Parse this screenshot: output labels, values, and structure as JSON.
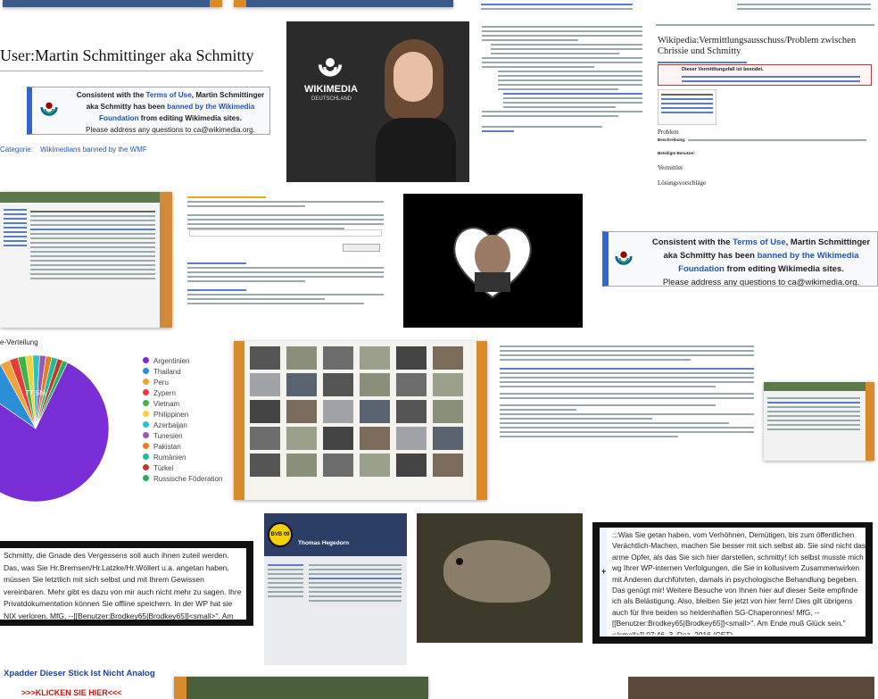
{
  "user_tile": {
    "heading": "User:Martin Schmittinger aka Schmitty",
    "notice_prefix": "Consistent with the ",
    "terms_link": "Terms of Use",
    "notice_mid": ", Martin Schmittinger aka Schmitty has been ",
    "banned_link": "banned by the Wikimedia Foundation",
    "notice_end": " from editing Wikimedia sites.",
    "contact": "Please address any questions to ca@wikimedia.org.",
    "category_label": "Categorie:",
    "category_value": "Wikimedians banned by the WMF"
  },
  "wmde_tile": {
    "logo_line1": "WIKIMEDIA",
    "logo_line2": "DEUTSCHLAND"
  },
  "vermittlung_tile": {
    "title": "Wikipedia:Vermittlungsausschuss/Problem zwischen Chrissie und Schmitty",
    "box_title": "Dieser Vermittlungsfall ist beendet.",
    "section1": "Problem",
    "section2": "Vermittler",
    "section3": "Lösungsvorschläge",
    "label_beschreibung": "Beschreibung:",
    "label_beteiligte": "Beteiligte Benutzer:"
  },
  "notice_tile": {
    "prefix": "Consistent with the ",
    "terms_link": "Terms of Use",
    "mid": ", Martin Schmittinger aka Schmitty has been ",
    "banned_link": "banned by the Wikimedia Foundation",
    "end": " from editing Wikimedia sites.",
    "contact": "Please address any questions to ca@wikimedia.org."
  },
  "chart_data": {
    "type": "pie",
    "title": "e-Verteilung",
    "categories": [
      "Argentinien",
      "Thailand",
      "Peru",
      "Zypern",
      "Vietnam",
      "Philippinen",
      "Azerbaijan",
      "Tunesien",
      "Pakistan",
      "Rumänien",
      "Türkei",
      "Russische Föderation"
    ],
    "values": [
      77.5,
      7.3,
      2.2,
      1.9,
      1.7,
      1.6,
      1.5,
      1.4,
      1.3,
      1.3,
      1.2,
      1.1
    ],
    "data_labels": [
      "77,5%",
      "7,3%"
    ],
    "colors": [
      "#7a2fd6",
      "#2a8fd6",
      "#f2a23a",
      "#e63b3b",
      "#3bb54a",
      "#f2d23a",
      "#2ac2c2",
      "#9b59b6",
      "#e67e22",
      "#1abc9c",
      "#c0392b",
      "#27ae60"
    ],
    "legend_position": "right"
  },
  "comment_tile": {
    "text": "Schmitty, die Gnade des Vergessens soll auch ihnen zuteil werden. Das, was Sie Hr.Bremsen/Hr.Latzke/Hr.Wöllert u.a. angetan haben, müssen Sie letztlich mit sich selbst und mit Ihrem Gewissen vereinbaren. Mehr gibt es dazu von mir auch nicht mehr zu sagen. Ihre Privatdokumentation können Sie offline speichern. In der WP hat sie NIX verloren. MfG, --[[Benutzer:Brodkey65|Brodkey65]]<small>\". Am Ende muß Glück sein.\"</small>]] 23:50, 2. Dez. 2016 (CET)"
  },
  "facebook_tile": {
    "name": "Thomas Hegedorn",
    "badge": "BVB 09"
  },
  "quote_tile": {
    "text": ":::Was Sie getan haben, vom Verhöhnen, Demütigen, bis zum öffentlichen Verächtlich-Machen, machen Sie besser mit sich selbst ab. Sie sind nicht das arme Opfer, als das Sie sich hier darstellen, schmitty! Ich selbst musste mich wg Ihrer WP-internen Verfolgungen, die Sie in kollusivem Zusammenwirken mit Anderen durchführten, damals in psychologische Behandlung begeben. Das genügt mir! Weitere Besuche von Ihnen hier auf dieser Seite empfinde ich als Belästigung. Also, bleiben Sie jetzt von hier fern! Dies gilt übrigens auch für Ihre beiden so heldenhaften SG-Chaperonnes! MfG, --[[Benutzer:Brodkey65|Brodkey65]]<small>\". Am Ende muß Glück sein.\"</small>]] 07:46, 3. Dez. 2016 (CET)"
  },
  "bottom": {
    "link1": "Xpadder Dieser Stick Ist Nicht Analog",
    "link2": ">>>KLICKEN SIE HIER<<<"
  }
}
